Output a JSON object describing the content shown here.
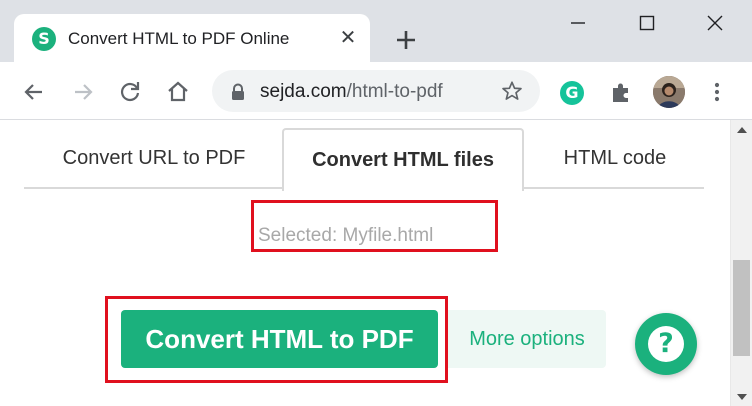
{
  "browser": {
    "tab": {
      "favicon_letter": "S",
      "title": "Convert HTML to PDF Online",
      "close_glyph": "✕"
    },
    "new_tab_glyph": "+",
    "address": {
      "host": "sejda.com",
      "path": "/html-to-pdf"
    },
    "grammarly_letter": "G"
  },
  "page": {
    "tabs": [
      {
        "label": "Convert URL to PDF",
        "active": false
      },
      {
        "label": "Convert HTML files",
        "active": true
      },
      {
        "label": "HTML code",
        "active": false
      }
    ],
    "selected_text": "Selected: Myfile.html",
    "convert_button": "Convert HTML to PDF",
    "more_options": "More options",
    "help_glyph": "?"
  },
  "colors": {
    "brand_green": "#1bb17d",
    "highlight_red": "#e0101e",
    "chrome_frame": "#dee1e6"
  }
}
